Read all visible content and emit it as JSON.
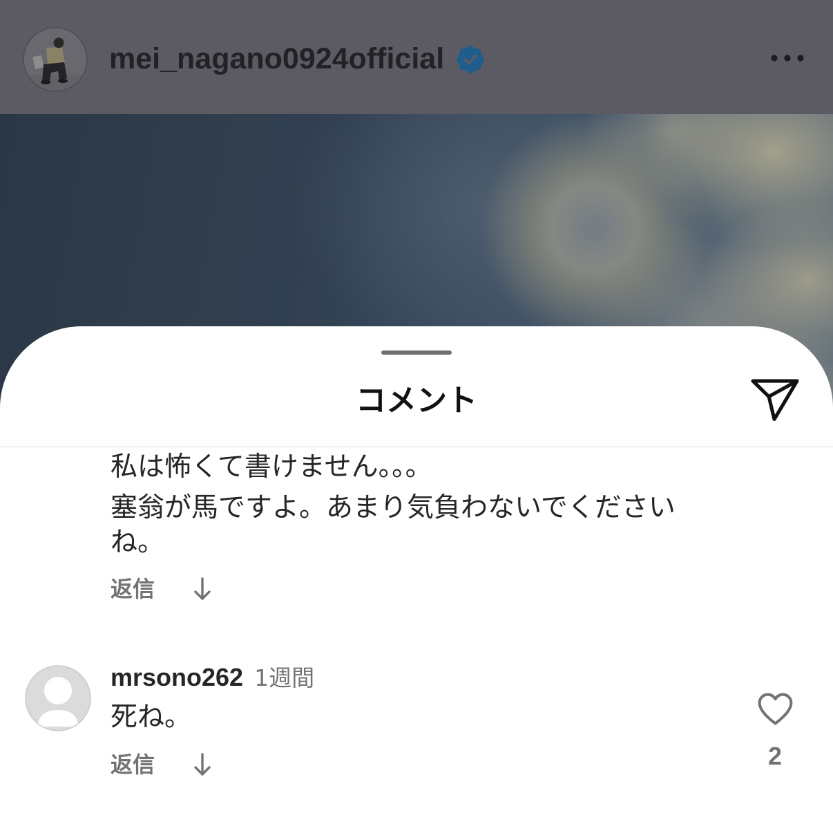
{
  "header": {
    "username": "mei_nagano0924official",
    "avatar_icon": "profile-photo",
    "verified_icon": "verified-badge-icon",
    "more_icon": "more-horizontal-icon"
  },
  "sheet": {
    "title": "コメント",
    "handle_icon": "drag-handle",
    "share_icon": "send-icon"
  },
  "comments": [
    {
      "lines": [
        "私は怖くて書けません。。。",
        "塞翁が馬ですよ。あまり気負わないでください",
        "ね。"
      ],
      "reply_label": "返信",
      "expand_icon": "arrow-down-icon"
    },
    {
      "username": "mrsono262",
      "time": "1週間",
      "avatar_icon": "default-avatar-icon",
      "lines": [
        "死ね。"
      ],
      "reply_label": "返信",
      "expand_icon": "arrow-down-icon",
      "like_icon": "heart-icon",
      "like_count": "2"
    }
  ],
  "colors": {
    "header_dimmed": "#5c5b63",
    "verified_badge": "#1f5d8d",
    "primary_text": "#262626",
    "secondary_text": "#737373",
    "sheet_background": "#ffffff",
    "divider": "#dbdbdb"
  }
}
